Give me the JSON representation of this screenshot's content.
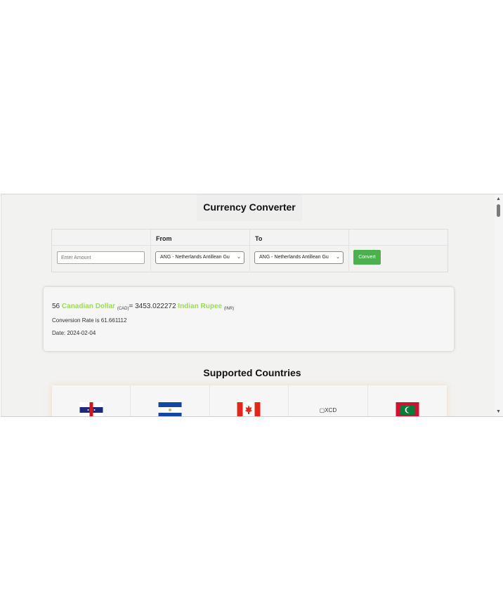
{
  "header": {
    "title": "Currency Converter"
  },
  "converter": {
    "from_label": "From",
    "to_label": "To",
    "amount_placeholder": "Enter Amount",
    "from_selected": "ANG - Netherlands Antillean Gu",
    "to_selected": "ANG - Netherlands Antillean Gu",
    "convert_label": "Convert"
  },
  "result": {
    "amount": "56",
    "from_name": "Canadian Dollar",
    "from_code": "(CAD)",
    "equals_value": "= 3453.022272",
    "to_name": "Indian Rupee",
    "to_code": "(INR)",
    "rate_text": "Conversion Rate is 61.661112",
    "date_text": "Date: 2024-02-04"
  },
  "supported": {
    "title": "Supported Countries",
    "flags": [
      {
        "icon": "netherlands-antilles-flag-icon"
      },
      {
        "icon": "el-salvador-flag-icon"
      },
      {
        "icon": "canada-flag-icon"
      },
      {
        "alt": "XCD"
      },
      {
        "icon": "maldives-flag-icon"
      }
    ]
  },
  "colors": {
    "accent_green": "#4caf50",
    "currency_name": "#9bdc5a"
  }
}
